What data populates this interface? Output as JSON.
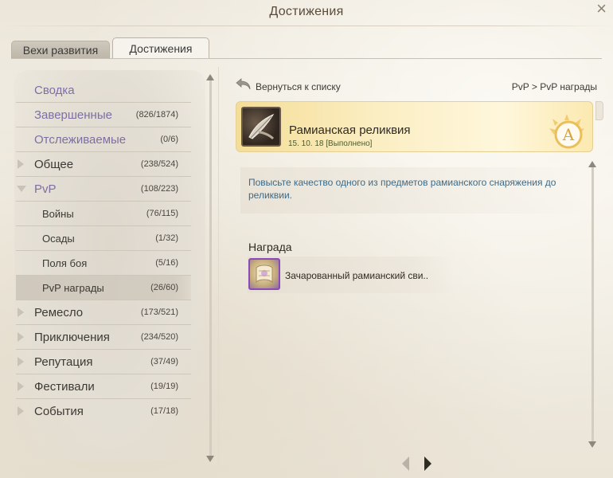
{
  "window": {
    "title": "Достижения",
    "close_glyph": "×"
  },
  "tabs": [
    {
      "label": "Вехи развития",
      "active": false
    },
    {
      "label": "Достижения",
      "active": true
    }
  ],
  "sidebar": {
    "items": [
      {
        "label": "Сводка",
        "count": "",
        "style": "purple",
        "expander": "none"
      },
      {
        "label": "Завершенные",
        "count": "(826/1874)",
        "style": "purple",
        "expander": "none"
      },
      {
        "label": "Отслеживаемые",
        "count": "(0/6)",
        "style": "purple",
        "expander": "none"
      },
      {
        "label": "Общее",
        "count": "(238/524)",
        "style": "normal",
        "expander": "collapsed"
      },
      {
        "label": "PvP",
        "count": "(108/223)",
        "style": "purple",
        "expander": "expanded"
      },
      {
        "label": "Войны",
        "count": "(76/115)",
        "style": "sub",
        "expander": "none"
      },
      {
        "label": "Осады",
        "count": "(1/32)",
        "style": "sub",
        "expander": "none"
      },
      {
        "label": "Поля боя",
        "count": "(5/16)",
        "style": "sub",
        "expander": "none"
      },
      {
        "label": "PvP награды",
        "count": "(26/60)",
        "style": "sub",
        "expander": "none",
        "selected": true
      },
      {
        "label": "Ремесло",
        "count": "(173/521)",
        "style": "normal",
        "expander": "collapsed"
      },
      {
        "label": "Приключения",
        "count": "(234/520)",
        "style": "normal",
        "expander": "collapsed"
      },
      {
        "label": "Репутация",
        "count": "(37/49)",
        "style": "normal",
        "expander": "collapsed"
      },
      {
        "label": "Фестивали",
        "count": "(19/19)",
        "style": "normal",
        "expander": "collapsed"
      },
      {
        "label": "События",
        "count": "(17/18)",
        "style": "normal",
        "expander": "collapsed"
      }
    ]
  },
  "main": {
    "back_label": "Вернуться к списку",
    "breadcrumb": "PvP > PvP награды",
    "achievement": {
      "name": "Рамианская реликвия",
      "date": "15. 10. 18 [Выполнено]",
      "badge_letter": "A"
    },
    "description": "Повысьте качество одного из предметов рамианского снаряжения до реликвии.",
    "reward": {
      "title": "Награда",
      "item_name": "Зачарованный рамианский сви.."
    }
  },
  "colors": {
    "accent_purple": "#7d6fa2",
    "description_blue": "#3b6b8a",
    "reward_border": "#8a4bb8",
    "card_gold": "#f4dd96"
  },
  "icons": {
    "back": "back-arrow-icon",
    "achievement": "feather-scroll-icon",
    "badge": "golden-sun-badge-icon",
    "reward": "enchanted-scroll-icon"
  }
}
